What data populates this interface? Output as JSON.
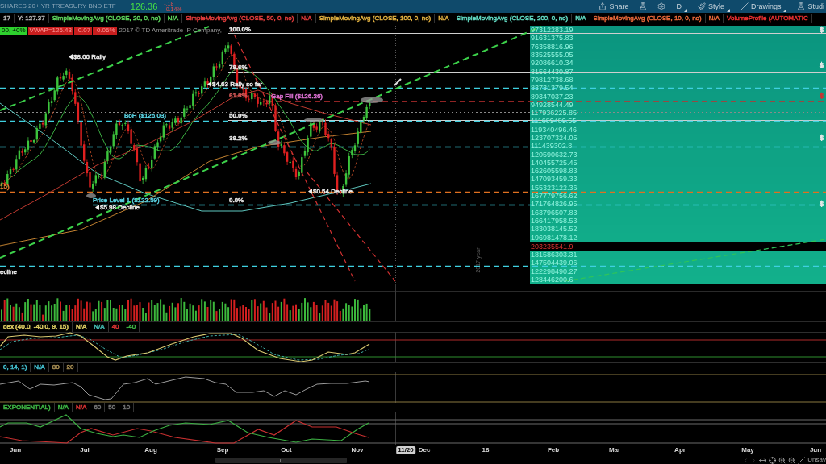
{
  "header": {
    "title": "SHARES 20+ YR TREASURY BND ETF",
    "last": "126.36",
    "net_change": "-.18",
    "percent_change": "-0.14%"
  },
  "toolbar": [
    {
      "kind": "share",
      "label": "Share",
      "caret": false
    },
    {
      "kind": "flask",
      "caret": false
    },
    {
      "kind": "gear",
      "caret": false
    },
    {
      "kind": "text",
      "label": "D",
      "caret": true
    },
    {
      "kind": "style",
      "label": "Style",
      "caret": true
    },
    {
      "kind": "drawings",
      "label": "Drawings",
      "caret": true
    },
    {
      "kind": "studies",
      "label": "Studi",
      "caret": false
    }
  ],
  "study_line": [
    {
      "text": "17",
      "color": "#b4b4b4"
    },
    {
      "text": "Y: 127.37",
      "color": "#b4b4b4"
    },
    {
      "text": "SimpleMovingAvg (CLOSE, 20, 0, no)",
      "color": "#5cd35c"
    },
    {
      "text": "N/A",
      "color": "#5cd35c"
    },
    {
      "text": "SimpleMovingAvg (CLOSE, 50, 0, no)",
      "color": "#e03c3c"
    },
    {
      "text": "N/A",
      "color": "#e03c3c"
    },
    {
      "text": "SimpleMovingAvg (CLOSE, 100, 0, no)",
      "color": "#e0b040"
    },
    {
      "text": "N/A",
      "color": "#e0b040"
    },
    {
      "text": "SimpleMovingAvg (CLOSE, 200, 0, no)",
      "color": "#60d8c0"
    },
    {
      "text": "N/A",
      "color": "#60d8c0"
    },
    {
      "text": "SimpleMovingAvg (CLOSE, 10, 0, no)",
      "color": "#e8683a"
    },
    {
      "text": "N/A",
      "color": "#e8683a"
    },
    {
      "text": "VolumeProfile (AUTOMATIC",
      "color": "#e83030"
    }
  ],
  "price_chart": {
    "legend_chips": [
      {
        "text": "00, +0%",
        "color": "#2ed12e"
      },
      {
        "text": "VWAP=126.43",
        "color": "#c81e1e"
      },
      {
        "text": "-0.07",
        "color": "#c81e1e"
      },
      {
        "text": "-0.06%",
        "color": "#c81e1e"
      }
    ],
    "copyright": "2017 © TD Ameritrade IP Company,",
    "fib_levels": [
      {
        "label": "100.0%",
        "color": "#e8e8e8"
      },
      {
        "label": "78.6%",
        "color": "#e8e8e8"
      },
      {
        "label": "61.8%",
        "color": "#d05858"
      },
      {
        "label": "50.0%",
        "color": "#e8e8e8"
      },
      {
        "label": "38.2%",
        "color": "#e8e8e8"
      },
      {
        "label": "0.0%",
        "color": "#e8e8e8"
      }
    ],
    "annotations": [
      {
        "text": "$8.66 Rally",
        "color": "#e8e8e8",
        "pointer": true
      },
      {
        "text": "$4.63 Rally so far",
        "color": "#e8e8e8",
        "pointer": true
      },
      {
        "text": "BoH ($126.03)",
        "color": "#58d0e0",
        "pointer": false
      },
      {
        "text": "Gap Fill ($126.26)",
        "color": "#d870d0",
        "pointer": false
      },
      {
        "text": "Price Level 1 ($122.59)",
        "color": "#58d0e0",
        "pointer": false
      },
      {
        "text": "$5.98 Decline",
        "color": "#e8e8e8",
        "pointer": true
      },
      {
        "text": "$0.54 Decline",
        "color": "#e8e8e8",
        "pointer": true
      },
      {
        "text": "15)",
        "color": "#e07a30",
        "pointer": false
      },
      {
        "text": "ecline",
        "color": "#e8e8e8",
        "pointer": false
      }
    ],
    "year_marker": "2017 year",
    "edge_tags": [
      {
        "text": "$",
        "color": "#e8e8e8"
      },
      {
        "text": "$",
        "color": "#e8e8e8"
      },
      {
        "text": "$",
        "color": "#d03030"
      },
      {
        "text": "$",
        "color": "#e8e8e8"
      },
      {
        "text": "$",
        "color": "#e8e8e8"
      }
    ],
    "volume_profile": [
      {
        "value": "97312283.19",
        "poc": false
      },
      {
        "value": "91631375.83",
        "poc": false
      },
      {
        "value": "76358816.96",
        "poc": false
      },
      {
        "value": "83525555.05",
        "poc": false
      },
      {
        "value": "92086610.34",
        "poc": false
      },
      {
        "value": "81564430.87",
        "poc": false
      },
      {
        "value": "79812738.68",
        "poc": false
      },
      {
        "value": "83731379.54",
        "poc": false
      },
      {
        "value": "89347037.23",
        "poc": false
      },
      {
        "value": "94928544.49",
        "poc": false
      },
      {
        "value": "117936225.85",
        "poc": false
      },
      {
        "value": "111689489.55",
        "poc": false
      },
      {
        "value": "119340496.46",
        "poc": false
      },
      {
        "value": "123707324.05",
        "poc": false
      },
      {
        "value": "111439302.8",
        "poc": false
      },
      {
        "value": "120590632.73",
        "poc": false
      },
      {
        "value": "140455725.45",
        "poc": false
      },
      {
        "value": "162605598.83",
        "poc": false
      },
      {
        "value": "147093459.33",
        "poc": false
      },
      {
        "value": "155323122.36",
        "poc": false
      },
      {
        "value": "167779756.62",
        "poc": false
      },
      {
        "value": "171764826.95",
        "poc": false
      },
      {
        "value": "163796507.83",
        "poc": false
      },
      {
        "value": "166417958.53",
        "poc": false
      },
      {
        "value": "183038145.52",
        "poc": false
      },
      {
        "value": "196981478.12",
        "poc": false
      },
      {
        "value": "203235541.9",
        "poc": true
      },
      {
        "value": "181586303.31",
        "poc": false
      },
      {
        "value": "147504439.06",
        "poc": false
      },
      {
        "value": "122298490.27",
        "poc": false
      },
      {
        "value": "128446200.6",
        "poc": false
      }
    ]
  },
  "indicator_panels": [
    {
      "kind": "crossover",
      "chips": [
        {
          "text": "dex (40.0, -40.0, 9, 15)",
          "color": "#d8c860"
        },
        {
          "text": "N/A",
          "color": "#d8c860"
        },
        {
          "text": "N/A",
          "color": "#40b0a8"
        },
        {
          "text": "40",
          "color": "#d03030"
        },
        {
          "text": "-40",
          "color": "#3cb043"
        }
      ]
    },
    {
      "kind": "single",
      "chips": [
        {
          "text": "0, 14, 1)",
          "color": "#40b8c8"
        },
        {
          "text": "N/A",
          "color": "#40b8c8"
        },
        {
          "text": "80",
          "color": "#a08850"
        },
        {
          "text": "20",
          "color": "#a08850"
        }
      ]
    },
    {
      "kind": "pair",
      "chips": [
        {
          "text": "EXPONENTIAL)",
          "color": "#3cb043"
        },
        {
          "text": "N/A",
          "color": "#3cb043"
        },
        {
          "text": "N/A",
          "color": "#d03030"
        },
        {
          "text": "60",
          "color": "#707070"
        },
        {
          "text": "50",
          "color": "#707070"
        },
        {
          "text": "10",
          "color": "#707070"
        }
      ]
    }
  ],
  "time_axis": [
    {
      "label": "Jun",
      "highlighted": false
    },
    {
      "label": "Jul",
      "highlighted": false
    },
    {
      "label": "Aug",
      "highlighted": false
    },
    {
      "label": "Sep",
      "highlighted": false
    },
    {
      "label": "Oct",
      "highlighted": false
    },
    {
      "label": "Nov",
      "highlighted": false
    },
    {
      "label": "11/20",
      "highlighted": true
    },
    {
      "label": "Dec",
      "highlighted": false
    },
    {
      "label": "18",
      "highlighted": false
    },
    {
      "label": "Feb",
      "highlighted": false
    },
    {
      "label": "Mar",
      "highlighted": false
    },
    {
      "label": "Apr",
      "highlighted": false
    },
    {
      "label": "May",
      "highlighted": false
    },
    {
      "label": "Jun",
      "highlighted": false
    }
  ],
  "footer": {
    "status": "Unsav"
  }
}
